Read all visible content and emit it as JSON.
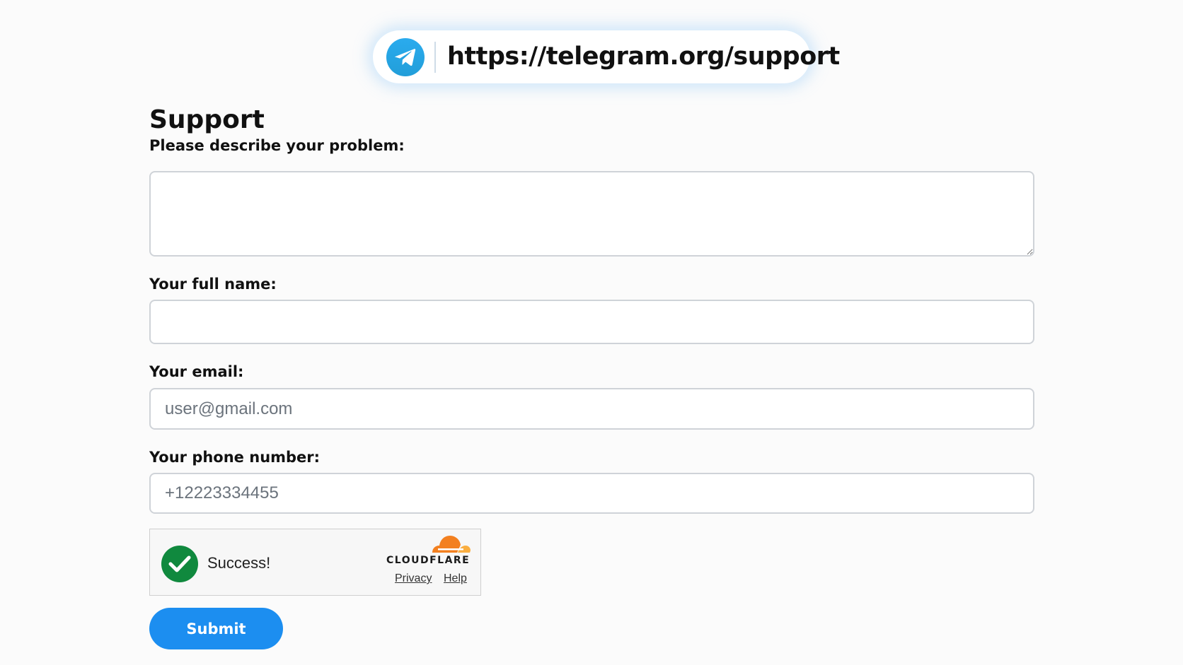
{
  "address_bar": {
    "url": "https://telegram.org/support",
    "logo_icon": "telegram-paper-plane-icon",
    "logo_color": "#2AABEE"
  },
  "page": {
    "title": "Support"
  },
  "form": {
    "problem": {
      "label": "Please describe your problem:",
      "value": "",
      "placeholder": ""
    },
    "full_name": {
      "label": "Your full name:",
      "value": "",
      "placeholder": ""
    },
    "email": {
      "label": "Your email:",
      "value": "",
      "placeholder": "user@gmail.com"
    },
    "phone": {
      "label": "Your phone number:",
      "value": "",
      "placeholder": "+12223334455"
    },
    "submit_label": "Submit",
    "submit_color": "#1C8EF0"
  },
  "captcha": {
    "status_text": "Success!",
    "status_icon": "green-checkmark-icon",
    "status_color": "#10893E",
    "brand": "CLOUDFLARE",
    "brand_color": "#F38020",
    "privacy_label": "Privacy",
    "help_label": "Help"
  }
}
